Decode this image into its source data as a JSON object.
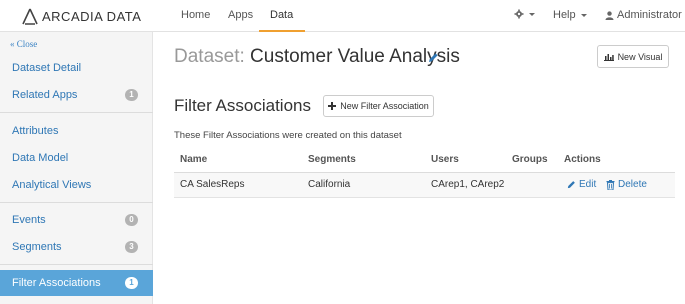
{
  "brand": {
    "name": "ARCADIA DATA"
  },
  "nav": {
    "links": [
      {
        "label": "Home"
      },
      {
        "label": "Apps"
      },
      {
        "label": "Data"
      }
    ],
    "help_label": "Help",
    "user_label": "Administrator"
  },
  "sidebar": {
    "close_label": "« Close",
    "items": [
      {
        "label": "Dataset Detail",
        "badge": ""
      },
      {
        "label": "Related Apps",
        "badge": "1"
      },
      {
        "label": "Attributes",
        "badge": ""
      },
      {
        "label": "Data Model",
        "badge": ""
      },
      {
        "label": "Analytical Views",
        "badge": ""
      },
      {
        "label": "Events",
        "badge": "0"
      },
      {
        "label": "Segments",
        "badge": "3"
      },
      {
        "label": "Filter Associations",
        "badge": "1"
      }
    ],
    "active_item": "Filter Associations"
  },
  "page": {
    "dataset_prefix": "Dataset:",
    "dataset_name": "Customer Value Analysis",
    "new_visual_label": "New Visual",
    "section_title": "Filter Associations",
    "new_filter_label": "New Filter Association",
    "description": "These Filter Associations were created on this dataset"
  },
  "table": {
    "headers": [
      "Name",
      "Segments",
      "Users",
      "Groups",
      "Actions"
    ],
    "rows": [
      {
        "name": "CA SalesReps",
        "segments": "California",
        "users": "CArep1, CArep2",
        "groups": "",
        "edit_label": "Edit",
        "delete_label": "Delete"
      }
    ]
  },
  "colors": {
    "accent": "#5aa5d9",
    "link": "#2f77b5",
    "nav_active": "#f0a030"
  }
}
